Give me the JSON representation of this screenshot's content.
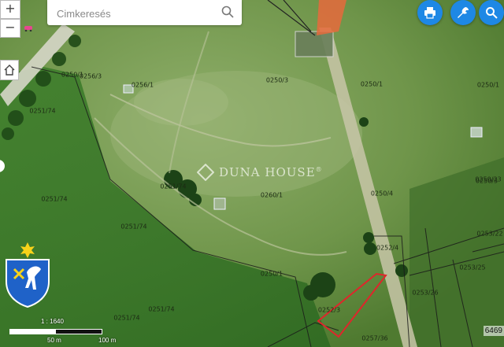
{
  "search": {
    "placeholder": "Cimkeresés"
  },
  "zoom": {
    "in_label": "+",
    "out_label": "−"
  },
  "toolbar": {
    "print_icon": "print-icon",
    "tools_icon": "wrench-icon",
    "search_icon": "search-icon",
    "accent": "#1e88e5"
  },
  "watermark": {
    "brand": "DUNA HOUSE",
    "mark": "®"
  },
  "scale": {
    "ratio": "1 : 1640",
    "mid_label": "50 m",
    "end_label": "100 m"
  },
  "parcels": [
    "0250/1",
    "0256/3",
    "0256/1",
    "0251/74",
    "0251/74",
    "0250/3",
    "0250/1",
    "0251/74",
    "0251/74",
    "0251/74",
    "0251/74",
    "0260/1",
    "0250/4",
    "0250/3",
    "0252/4",
    "0253/22",
    "0253/25",
    "0253/26",
    "0250/23",
    "0252/3",
    "0257/36",
    "0250/1",
    "0250/1"
  ],
  "corner_number": "6469"
}
